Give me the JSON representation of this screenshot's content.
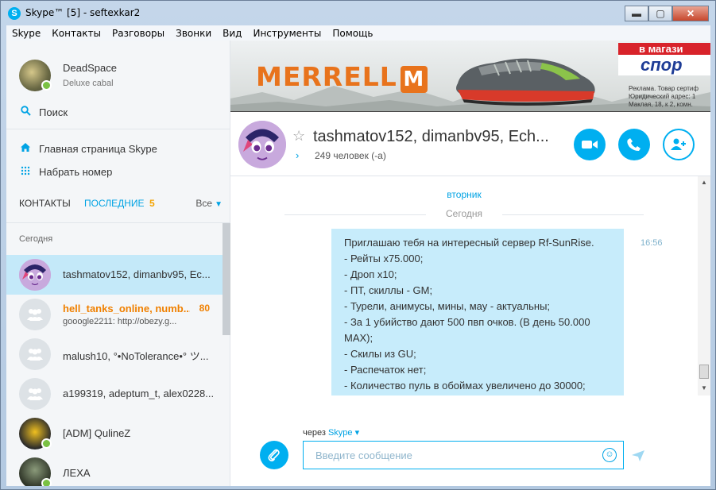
{
  "window": {
    "title": "Skype™ [5] - seftexkar2",
    "app_icon_letter": "S",
    "controls": {
      "minimize": "▬",
      "maximize": "▢",
      "close": "✕"
    }
  },
  "menu": [
    "Skype",
    "Контакты",
    "Разговоры",
    "Звонки",
    "Вид",
    "Инструменты",
    "Помощь"
  ],
  "profile": {
    "name": "DeadSpace",
    "mood": "Deluxe cabal"
  },
  "sidebar": {
    "search_label": "Поиск",
    "home_label": "Главная страница Skype",
    "dial_label": "Набрать номер",
    "tab_contacts": "КОНТАКТЫ",
    "tab_recent": "ПОСЛЕДНИЕ",
    "tab_recent_count": "5",
    "filter_label": "Все",
    "section_today": "Сегодня",
    "items": [
      {
        "name": "tashmatov152, dimanbv95, Ec...",
        "sub": "",
        "count": ""
      },
      {
        "name": "hell_tanks_online, numb...",
        "sub": "gooogle2211: http://obezy.g...",
        "count": "80"
      },
      {
        "name": "malush10, °•NoTolerance•° ツ...",
        "sub": "",
        "count": ""
      },
      {
        "name": "a199319, adeptum_t, alex0228...",
        "sub": "",
        "count": ""
      },
      {
        "name": "[ADM] QulineZ",
        "sub": "",
        "count": ""
      },
      {
        "name": "ЛЕХА",
        "sub": "",
        "count": ""
      }
    ]
  },
  "ad": {
    "brand": "MERRELL",
    "brand_mark": "M",
    "store_top": "в магази",
    "store_name": "спор",
    "legal": [
      "Реклама. Товар сертиф",
      "Юридический адрес: 1",
      "Маклая, 18, к 2, комн."
    ]
  },
  "conversation": {
    "title": "tashmatov152, dimanbv95, Ech...",
    "participants": "249 человек (-а)"
  },
  "messages": {
    "day_tuesday": "вторник",
    "day_today": "Сегодня",
    "time": "16:56",
    "lines": [
      "Приглашаю тебя на интересный сервер Rf-SunRise.",
      "- Рейты х75.000;",
      "- Дроп х10;",
      "- ПТ, скиллы - GM;",
      "- Турели, анимусы, мины, мау - актуальны;",
      "- За 1 убийство дают 500 пвп очков. (В день 50.000",
      "MAX);",
      "- Скилы из GU;",
      "- Распечаток нет;",
      "- Количество пуль в обоймах увеличено до 30000;"
    ]
  },
  "composer": {
    "via_prefix": "через",
    "via_service": "Skype",
    "placeholder": "Введите сообщение"
  },
  "colors": {
    "accent": "#00aff0",
    "unread": "#f08000",
    "selected_row": "#c4e9f9",
    "bubble": "#c7ecfb",
    "online": "#7ac143"
  }
}
